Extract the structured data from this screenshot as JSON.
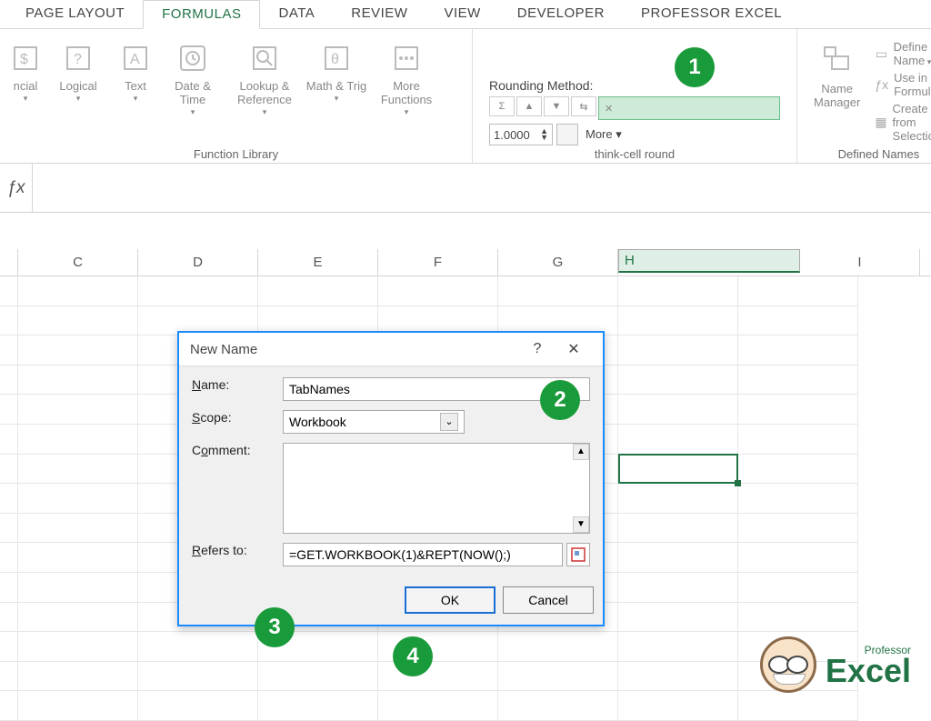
{
  "tabs": [
    "PAGE LAYOUT",
    "FORMULAS",
    "DATA",
    "REVIEW",
    "VIEW",
    "DEVELOPER",
    "PROFESSOR EXCEL"
  ],
  "active_tab": "FORMULAS",
  "ribbon": {
    "fnlib_label": "Function Library",
    "buttons": {
      "financial": "ncial",
      "logical": "Logical",
      "text": "Text",
      "datetime": "Date & Time",
      "lookup": "Lookup & Reference",
      "math": "Math & Trig",
      "more": "More Functions"
    },
    "rounding": {
      "title": "Rounding Method:",
      "spin": "1.0000",
      "more": "More",
      "group_label": "think-cell round"
    },
    "names": {
      "manager": "Name Manager",
      "define": "Define Name",
      "usein": "Use in Formula",
      "create": "Create from Selection",
      "group_label": "Defined Names"
    }
  },
  "columns": [
    "C",
    "D",
    "E",
    "F",
    "G",
    "H",
    "I"
  ],
  "selected_column": "H",
  "dialog": {
    "title": "New Name",
    "labels": {
      "name": "Name:",
      "scope": "Scope:",
      "comment": "Comment:",
      "refers": "Refers to:"
    },
    "name_value": "TabNames",
    "scope_value": "Workbook",
    "refers_value": "=GET.WORKBOOK(1)&REPT(NOW();)",
    "ok": "OK",
    "cancel": "Cancel"
  },
  "badges": {
    "b1": "1",
    "b2": "2",
    "b3": "3",
    "b4": "4"
  },
  "logo": {
    "small": "Professor",
    "big": "Excel"
  }
}
